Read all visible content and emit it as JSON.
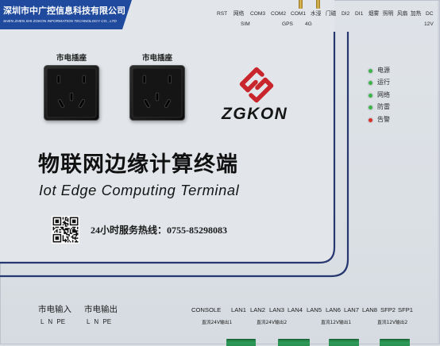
{
  "company": {
    "name_cn": "深圳市中广控信息科技有限公司",
    "name_en": "SHEN ZHEN SHI ZGKON INFORMATION TECHNOLOGY CO., LTD"
  },
  "top_ports": {
    "row1": [
      "RST",
      "网络",
      "COM3",
      "COM2",
      "COM1",
      "水浸",
      "门磁",
      "DI2",
      "DI1",
      "烟雾",
      "照明",
      "风扇",
      "加热",
      "DC"
    ],
    "row2": [
      "SIM",
      "GPS",
      "4G",
      "12V"
    ]
  },
  "sockets": {
    "left_label": "市电插座",
    "right_label": "市电插座",
    "icon": "power-outlet-icon"
  },
  "logo": {
    "icon": "zgkon-logo-icon",
    "brand": "ZGKON"
  },
  "indicators": [
    {
      "label": "电源",
      "led_color": "#3db54a"
    },
    {
      "label": "运行",
      "led_color": "#3db54a"
    },
    {
      "label": "网络",
      "led_color": "#3db54a"
    },
    {
      "label": "防雷",
      "led_color": "#3db54a"
    },
    {
      "label": "告警",
      "led_color": "#d8322c"
    }
  ],
  "title": {
    "cn": "物联网边缘计算终端",
    "en": "Iot Edge Computing Terminal"
  },
  "qr_code": {
    "icon": "qr-code-icon"
  },
  "hotline": "24小时服务热线：0755-85298083",
  "bottom": {
    "power_in": {
      "label": "市电输入",
      "pins": "L N PE"
    },
    "power_out": {
      "label": "市电输出",
      "pins": "L N PE"
    },
    "console": "CONSOLE",
    "ports": [
      "LAN1",
      "LAN2",
      "LAN3",
      "LAN4",
      "LAN5",
      "LAN6",
      "LAN7",
      "LAN8",
      "SFP2",
      "SFP1"
    ],
    "dc_outputs": [
      "直流24V输出1",
      "直流24V输出2",
      "直流12V输出1",
      "直流12V输出2"
    ]
  },
  "colors": {
    "banner": "#1f4a9e",
    "groove_line": "#27376f",
    "logo_red": "#c8262c",
    "terminal_green": "#2e9a58"
  }
}
